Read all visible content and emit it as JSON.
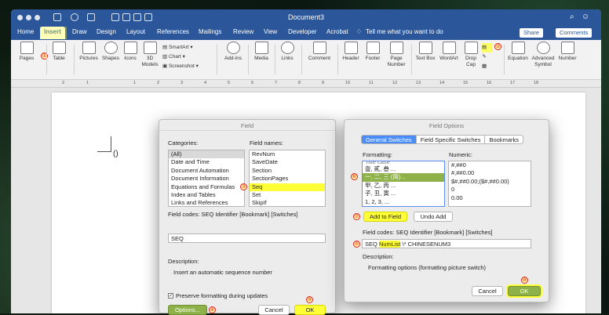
{
  "window": {
    "title": "Document3"
  },
  "menu": {
    "items": [
      "Home",
      "Insert",
      "Draw",
      "Design",
      "Layout",
      "References",
      "Mailings",
      "Review",
      "View",
      "Developer",
      "Acrobat"
    ],
    "tell_me": "Tell me what you want to do",
    "share": "Share",
    "comments": "Comments"
  },
  "ribbon": {
    "buttons": [
      "Pages",
      "Table",
      "Pictures",
      "Shapes",
      "Icons",
      "3D Models",
      "SmartArt",
      "Chart",
      "Screenshot",
      "Add-ins",
      "Media",
      "Links",
      "Comment",
      "Header",
      "Footer",
      "Page Number",
      "Text Box",
      "WordArt",
      "Drop Cap",
      "Equation",
      "Advanced Symbol",
      "Number"
    ]
  },
  "ruler": {
    "ticks": [
      "2",
      "1",
      "1",
      "2",
      "3",
      "4",
      "5",
      "6",
      "7",
      "8",
      "9",
      "10",
      "11",
      "12",
      "13",
      "14",
      "15",
      "16",
      "17",
      "18"
    ]
  },
  "document": {
    "paren": "()"
  },
  "markers": {
    "m1": "①",
    "m2": "②",
    "m3": "③",
    "m4": "④",
    "m5": "⑤",
    "m6": "⑥",
    "m7": "⑦",
    "m8": "⑧",
    "m9": "⑨"
  },
  "field_dialog": {
    "title": "Field",
    "categories_label": "Categories:",
    "categories": [
      "(All)",
      "Date and Time",
      "Document Automation",
      "Document Information",
      "Equations and Formulas",
      "Index and Tables",
      "Links and References"
    ],
    "field_names_label": "Field names:",
    "field_names": [
      "RevNum",
      "SaveDate",
      "Section",
      "SectionPages",
      "Seq",
      "Set",
      "SkipIf"
    ],
    "field_codes_label": "Field codes:",
    "field_codes_syntax": "SEQ Identifier [Bookmark] [Switches]",
    "field_code_value": "SEQ",
    "description_label": "Description:",
    "description_text": "Insert an automatic sequence number",
    "preserve_label": "Preserve formatting during updates",
    "options_button": "Options...",
    "cancel_button": "Cancel",
    "ok_button": "OK"
  },
  "options_dialog": {
    "title": "Field Options",
    "tabs": [
      "General Switches",
      "Field Specific Switches",
      "Bookmarks"
    ],
    "formatting_label": "Formatting:",
    "formatting": [
      "Title case",
      "壹, 貳, 叁 ...",
      "一, 二, 三 (简)...",
      "甲, 乙, 丙 ...",
      "子, 丑, 寅 ...",
      "1, 2, 3, ..."
    ],
    "numeric_label": "Numeric:",
    "numeric": [
      "#,##0",
      "#,##0.00",
      "$#,##0.00;($#,##0.00)",
      "0",
      "0.00"
    ],
    "add_to_field": "Add to Field",
    "undo_add": "Undo Add",
    "field_codes_label": "Field codes:",
    "field_codes_syntax": "SEQ Identifier [Bookmark] [Switches]",
    "code_pre": "SEQ",
    "code_hl": "NumList",
    "code_post": "\\* CHINESENUM3",
    "description_label": "Description:",
    "description_text": "Formatting options (formatting picture switch)",
    "cancel_button": "Cancel",
    "ok_button": "OK"
  },
  "colors": {
    "word_blue": "#2b579a",
    "highlight": "#ffff38",
    "selection_green": "#8fb14a",
    "marker_red": "#dd2222"
  }
}
